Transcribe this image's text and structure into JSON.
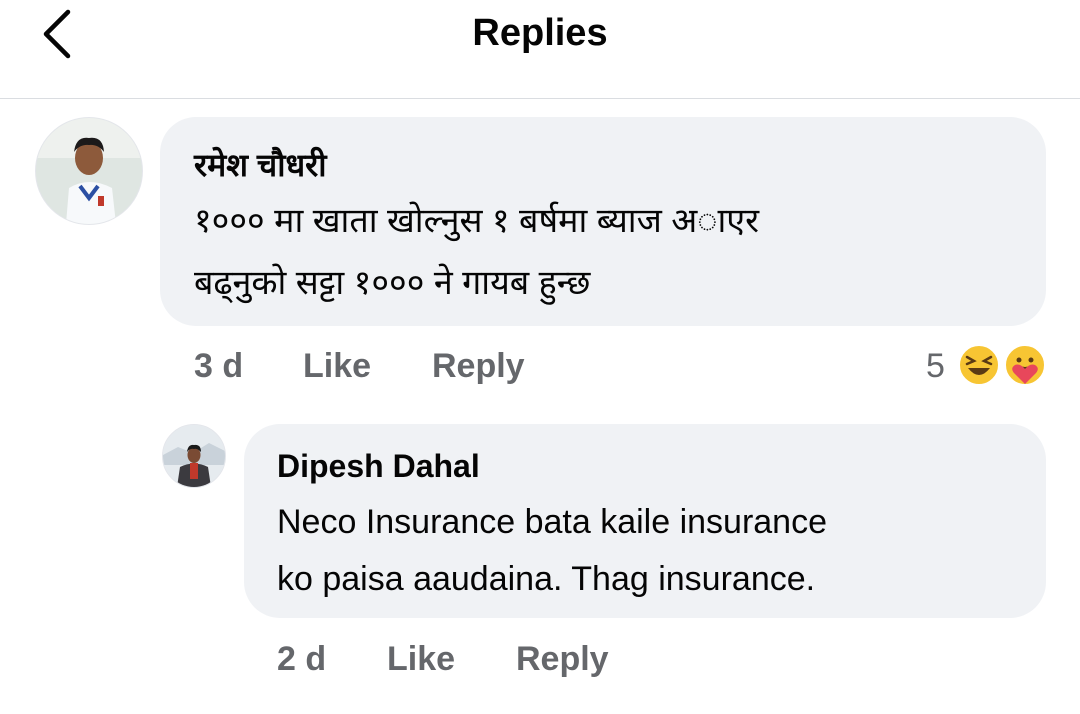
{
  "header": {
    "title": "Replies",
    "back_icon": "chevron-left-icon"
  },
  "comment": {
    "author": "रमेश चौधरी",
    "text_line1": "१००० मा खाता खोल्नुस १ बर्षमा ब्याज अाएर",
    "text_line2": "बढ्नुको सट्टा १००० ने गायब हुन्छ",
    "time": "3 d",
    "like_label": "Like",
    "reply_label": "Reply",
    "reaction_count": "5",
    "reactions": [
      "laughing-emoji-icon",
      "care-emoji-icon"
    ]
  },
  "reply": {
    "author": "Dipesh Dahal",
    "text_line1": "Neco Insurance bata kaile insurance",
    "text_line2": "ko paisa aaudaina. Thag insurance.",
    "time": "2 d",
    "like_label": "Like",
    "reply_label": "Reply"
  },
  "colors": {
    "bubble": "#f0f2f5",
    "meta_text": "#65676b",
    "divider": "#dadde1"
  }
}
